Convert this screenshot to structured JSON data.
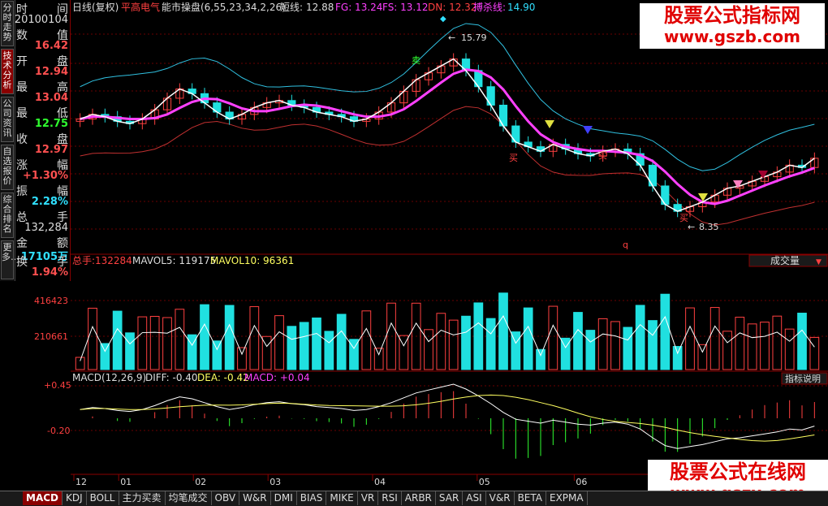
{
  "left_nav": [
    {
      "label": "分时走势",
      "active": false
    },
    {
      "label": "技术分析",
      "active": true
    },
    {
      "label": "公司资讯",
      "active": false
    },
    {
      "label": "自选报价",
      "active": false
    },
    {
      "label": "综合排名",
      "active": false
    },
    {
      "label": "更多…",
      "active": false
    }
  ],
  "info": {
    "time_label_l": "时",
    "time_label_r": "间",
    "time_value": "20100104",
    "value_label_l": "数",
    "value_label_r": "值",
    "value_value": "16.42",
    "open_label_l": "开",
    "open_label_r": "盘",
    "open_value": "12.94",
    "high_label_l": "最",
    "high_label_r": "高",
    "high_value": "13.04",
    "low_label_l": "最",
    "low_label_r": "低",
    "low_value": "12.75",
    "close_label_l": "收",
    "close_label_r": "盘",
    "close_value": "12.97",
    "chg_label_l": "涨",
    "chg_label_r": "幅",
    "chg_value": "+1.30%",
    "amp_label_l": "振",
    "amp_label_r": "幅",
    "amp_value": "2.28%",
    "vol_label_l": "总",
    "vol_label_r": "手",
    "vol_value": "132,284",
    "amt_label_l": "金",
    "amt_label_r": "额",
    "amt_value": "17105万",
    "turn_label_l": "换",
    "turn_label_r": "手",
    "turn_value": "1.94%"
  },
  "main_header": {
    "period": "日线(复权)",
    "stock": "平高电气",
    "indicator": "能市操盘(6,55,23,34,2,26)",
    "short_label": "短线:",
    "short_value": "12.88",
    "fg": "FG: 13.24",
    "fs": "FS: 13.12",
    "dn": "DN: 12.32",
    "bc_label": "搏杀线:",
    "bc_value": "14.90"
  },
  "annotations": {
    "high": "15.79",
    "low": "8.35",
    "buy": "买",
    "sell": "卖",
    "q": "q"
  },
  "volume_header": {
    "label": "总手:",
    "value": "132284",
    "ma5": "MAVOL5: 119175",
    "ma10": "MAVOL10: 96361",
    "selector": "成交量"
  },
  "volume_axis": [
    "416423",
    "210661"
  ],
  "macd_header": {
    "params": "MACD(12,26,9)",
    "diff": "DIFF: -0.40",
    "dea": "DEA: -0.42",
    "macd": "MACD: +0.04",
    "help": "指标说明"
  },
  "macd_axis": [
    "+0.45",
    "-0.20"
  ],
  "x_axis": [
    "12",
    "01",
    "02",
    "03",
    "04",
    "05",
    "06"
  ],
  "watermark_top": {
    "line1": "股票公式指标网",
    "line2": "www.gszb.com"
  },
  "watermark_bottom": {
    "line1": "股票公式在线网",
    "line2": "www.gszx.com"
  },
  "tabs": [
    "MACD",
    "KDJ",
    "BOLL",
    "主力买卖",
    "均笔成交",
    "OBV",
    "W&R",
    "DMI",
    "BIAS",
    "MIKE",
    "VR",
    "RSI",
    "ARBR",
    "SAR",
    "ASI",
    "V&R",
    "BETA",
    "EXPMA"
  ],
  "active_tab": "MACD",
  "colors": {
    "up": "#ff4040",
    "down": "#20e0e0",
    "ma": "#ff40ff",
    "white_line": "#ffffff",
    "bg": "#000000",
    "accent_red": "#8a0000"
  },
  "chart_data": [
    {
      "type": "candlestick",
      "title": "平高电气 日线(复权)",
      "x_ticks": [
        "12",
        "01",
        "02",
        "03",
        "04",
        "05",
        "06"
      ],
      "close": [
        12.9,
        13.1,
        13.0,
        12.8,
        12.7,
        12.9,
        13.3,
        13.8,
        14.2,
        14.0,
        13.6,
        13.2,
        12.9,
        13.1,
        13.4,
        13.6,
        13.7,
        13.5,
        13.4,
        13.2,
        13.1,
        13.0,
        12.8,
        12.9,
        13.2,
        13.6,
        14.1,
        14.6,
        14.9,
        15.2,
        15.5,
        15.0,
        14.3,
        13.5,
        12.6,
        11.9,
        11.7,
        11.5,
        11.8,
        11.6,
        11.4,
        11.3,
        11.5,
        11.6,
        11.4,
        10.9,
        10.0,
        9.2,
        8.9,
        9.1,
        9.3,
        9.6,
        9.9,
        10.0,
        10.2,
        10.4,
        10.6,
        10.9,
        10.8,
        11.2
      ],
      "volume_axis_ticks": [
        416423,
        210661
      ],
      "macd_axis_ticks": [
        0.45,
        -0.2
      ],
      "last_values": {
        "short": 12.88,
        "fg": 13.24,
        "fs": 13.12,
        "dn": 12.32,
        "bc": 14.9,
        "diff": -0.4,
        "dea": -0.42,
        "macd": 0.04
      }
    }
  ]
}
